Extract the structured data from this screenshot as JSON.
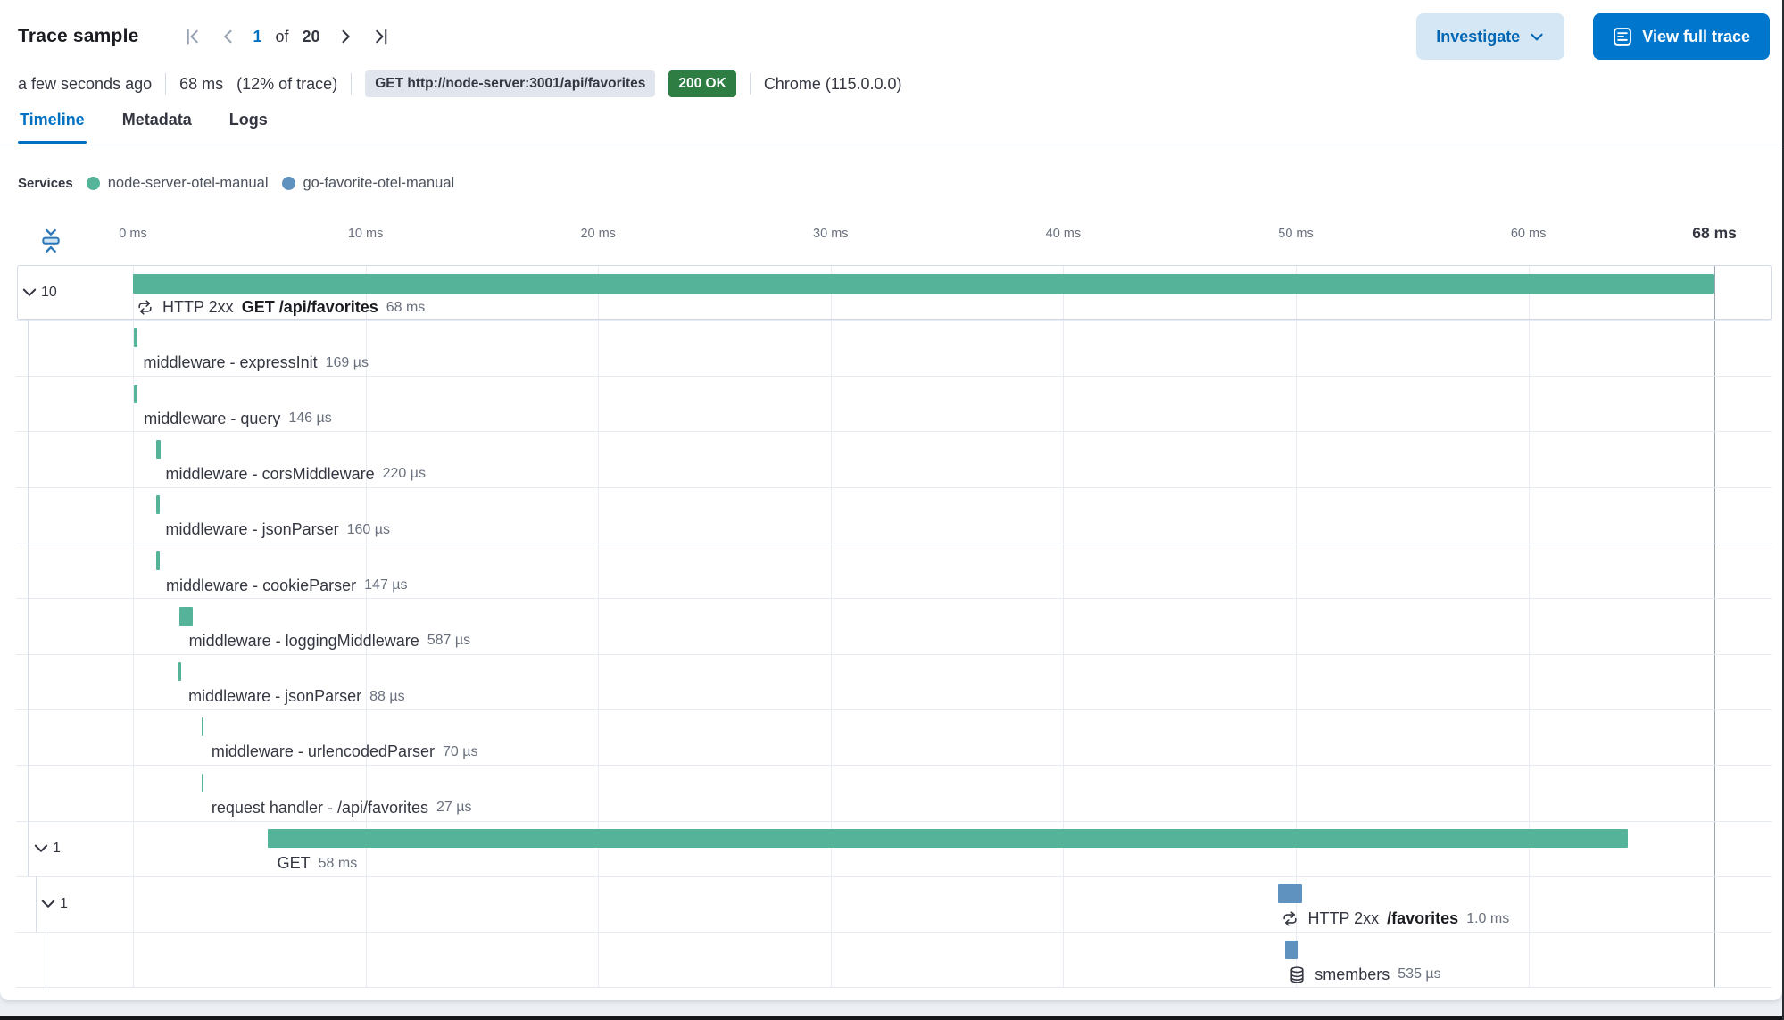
{
  "header": {
    "title": "Trace sample",
    "pagination": {
      "current": "1",
      "of_label": "of",
      "total": "20"
    },
    "investigate_label": "Investigate",
    "view_full_trace_label": "View full trace"
  },
  "summary": {
    "time_ago": "a few seconds ago",
    "duration": "68 ms",
    "trace_percent": "(12% of trace)",
    "request_badge": "GET http://node-server:3001/api/favorites",
    "status_badge": "200 OK",
    "user_agent": "Chrome (115.0.0.0)"
  },
  "tabs": [
    {
      "label": "Timeline",
      "active": true
    },
    {
      "label": "Metadata",
      "active": false
    },
    {
      "label": "Logs",
      "active": false
    }
  ],
  "services_legend": {
    "label": "Services",
    "items": [
      {
        "name": "node-server-otel-manual",
        "color": "#54b399"
      },
      {
        "name": "go-favorite-otel-manual",
        "color": "#6092c0"
      }
    ]
  },
  "colors": {
    "green": "#54b399",
    "blue": "#6092c0",
    "accent_blue": "#0077cc",
    "badge_green": "#2e7d43",
    "active_tab": "#0071c2"
  },
  "waterfall": {
    "axis": {
      "ticks": [
        {
          "ms": 0,
          "label": "0 ms"
        },
        {
          "ms": 10,
          "label": "10 ms"
        },
        {
          "ms": 20,
          "label": "20 ms"
        },
        {
          "ms": 30,
          "label": "30 ms"
        },
        {
          "ms": 40,
          "label": "40 ms"
        },
        {
          "ms": 50,
          "label": "50 ms"
        },
        {
          "ms": 60,
          "label": "60 ms"
        }
      ],
      "end_tick": {
        "ms": 68,
        "label": "68 ms"
      },
      "total_ms": 68
    },
    "rows": [
      {
        "name": "transaction-get-api-favorites",
        "level": 0,
        "accordion_count": "10",
        "focus": true,
        "icon": "http",
        "prefix": "HTTP 2xx",
        "title": "GET /api/favorites",
        "duration": "68 ms",
        "start_ms": 0,
        "duration_ms": 68,
        "service": "node"
      },
      {
        "name": "span-middleware-expressinit",
        "level": 1,
        "label": "middleware - expressInit",
        "duration": "169 µs",
        "start_ms": 0.02,
        "duration_ms": 0.169,
        "service": "node"
      },
      {
        "name": "span-middleware-query",
        "level": 1,
        "label": "middleware - query",
        "duration": "146 µs",
        "start_ms": 0.05,
        "duration_ms": 0.146,
        "service": "node"
      },
      {
        "name": "span-middleware-corsmiddleware",
        "level": 1,
        "label": "middleware - corsMiddleware",
        "duration": "220 µs",
        "start_ms": 0.98,
        "duration_ms": 0.22,
        "service": "node"
      },
      {
        "name": "span-middleware-jsonparser-1",
        "level": 1,
        "label": "middleware - jsonParser",
        "duration": "160 µs",
        "start_ms": 0.98,
        "duration_ms": 0.16,
        "service": "node"
      },
      {
        "name": "span-middleware-cookieparser",
        "level": 1,
        "label": "middleware - cookieParser",
        "duration": "147 µs",
        "start_ms": 1.0,
        "duration_ms": 0.147,
        "service": "node"
      },
      {
        "name": "span-middleware-loggingmiddleware",
        "level": 1,
        "label": "middleware - loggingMiddleware",
        "duration": "587 µs",
        "start_ms": 1.98,
        "duration_ms": 0.587,
        "service": "node"
      },
      {
        "name": "span-middleware-jsonparser-2",
        "level": 1,
        "label": "middleware - jsonParser",
        "duration": "88 µs",
        "start_ms": 1.96,
        "duration_ms": 0.088,
        "service": "node"
      },
      {
        "name": "span-middleware-urlencodedparser",
        "level": 1,
        "label": "middleware - urlencodedParser",
        "duration": "70 µs",
        "start_ms": 2.95,
        "duration_ms": 0.07,
        "service": "node"
      },
      {
        "name": "span-request-handler",
        "level": 1,
        "label": "request handler - /api/favorites",
        "duration": "27 µs",
        "start_ms": 2.95,
        "duration_ms": 0.027,
        "service": "node"
      },
      {
        "name": "span-get",
        "level": 1,
        "accordion_count": "1",
        "label": "GET",
        "duration": "58 ms",
        "start_ms": 5.78,
        "duration_ms": 58.5,
        "service": "node"
      },
      {
        "name": "transaction-favorites",
        "level": 2,
        "accordion_count": "1",
        "icon": "http",
        "prefix": "HTTP 2xx",
        "title": "/favorites",
        "duration": "1.0 ms",
        "start_ms": 49.25,
        "duration_ms": 1.0,
        "service": "go"
      },
      {
        "name": "span-smembers",
        "level": 3,
        "icon": "db",
        "label": "smembers",
        "duration": "535 µs",
        "start_ms": 49.55,
        "duration_ms": 0.535,
        "service": "go"
      }
    ]
  }
}
